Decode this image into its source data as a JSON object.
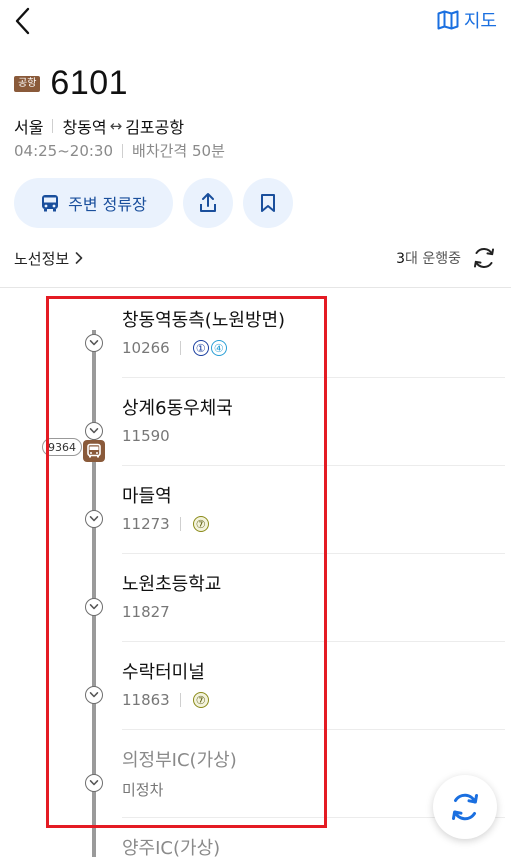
{
  "header": {
    "map_label": "지도"
  },
  "route": {
    "type_badge": "공항",
    "number": "6101",
    "region": "서울",
    "from": "창동역",
    "arrow": "↔",
    "to": "김포공항",
    "hours": "04:25~20:30",
    "interval": "배차간격 50분"
  },
  "actions": {
    "nearby_label": "주변 정류장"
  },
  "info": {
    "link_label": "노선정보",
    "running_count": "3",
    "running_suffix": "대 운행중"
  },
  "bus": {
    "plate": "9364"
  },
  "stops": [
    {
      "name": "창동역동측(노원방면)",
      "id": "10266",
      "lines": [
        "①",
        "④"
      ],
      "line_styles": [
        "blue",
        "teal"
      ]
    },
    {
      "name": "상계6동우체국",
      "id": "11590",
      "lines": []
    },
    {
      "name": "마들역",
      "id": "11273",
      "lines": [
        "⑦"
      ],
      "line_styles": [
        "olive"
      ]
    },
    {
      "name": "노원초등학교",
      "id": "11827",
      "lines": []
    },
    {
      "name": "수락터미널",
      "id": "11863",
      "lines": [
        "⑦"
      ],
      "line_styles": [
        "olive"
      ]
    },
    {
      "name": "의정부IC(가상)",
      "id": "미정차",
      "lines": []
    },
    {
      "name": "양주IC(가상)",
      "id": "",
      "lines": []
    }
  ],
  "colors": {
    "accent_blue": "#1a6fe0",
    "bus_brown": "#8a5a3a",
    "highlight_red": "#e41b23",
    "pill_bg": "#eaf2fd"
  }
}
